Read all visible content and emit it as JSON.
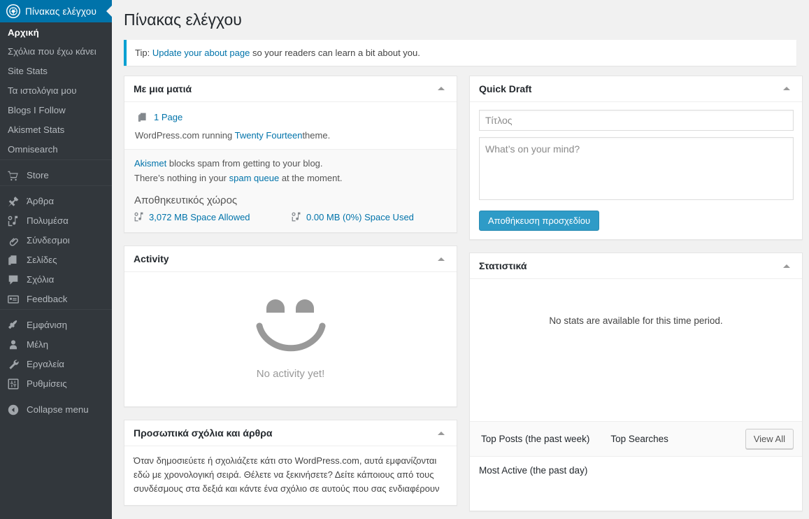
{
  "adminbar": {
    "logo_icon": "wordpress-dashboard-icon",
    "title": "Πίνακας ελέγχου"
  },
  "sidebar": {
    "top_items": [
      {
        "label": "Αρχική",
        "active": true
      },
      {
        "label": "Σχόλια που έχω κάνει",
        "active": false
      },
      {
        "label": "Site Stats",
        "active": false
      },
      {
        "label": "Τα ιστολόγια μου",
        "active": false
      },
      {
        "label": "Blogs I Follow",
        "active": false
      },
      {
        "label": "Akismet Stats",
        "active": false
      },
      {
        "label": "Omnisearch",
        "active": false
      }
    ],
    "store": {
      "label": "Store",
      "icon": "cart-icon"
    },
    "content_items": [
      {
        "label": "Άρθρα",
        "icon": "pin-icon"
      },
      {
        "label": "Πολυμέσα",
        "icon": "media-icon"
      },
      {
        "label": "Σύνδεσμοι",
        "icon": "link-icon"
      },
      {
        "label": "Σελίδες",
        "icon": "pages-icon"
      },
      {
        "label": "Σχόλια",
        "icon": "comment-icon"
      },
      {
        "label": "Feedback",
        "icon": "feedback-icon"
      }
    ],
    "admin_items": [
      {
        "label": "Εμφάνιση",
        "icon": "appearance-icon"
      },
      {
        "label": "Μέλη",
        "icon": "users-icon"
      },
      {
        "label": "Εργαλεία",
        "icon": "tools-icon"
      },
      {
        "label": "Ρυθμίσεις",
        "icon": "settings-icon"
      }
    ],
    "collapse": {
      "label": "Collapse menu",
      "icon": "collapse-arrow-icon"
    }
  },
  "page": {
    "title": "Πίνακας ελέγχου"
  },
  "tip": {
    "prefix": "Tip:",
    "link": "Update your about page",
    "suffix": "so your readers can learn a bit about you."
  },
  "glance": {
    "title": "Με μια ματιά",
    "page_count_link": "1 Page",
    "page_icon": "pages-icon",
    "version_prefix": "WordPress.com running",
    "theme_link": "Twenty Fourteen",
    "version_suffix": "theme.",
    "akismet_link": "Akismet",
    "akismet_text": "blocks spam from getting to your blog.",
    "spam_prefix": "There’s nothing in your",
    "spam_link": "spam queue",
    "spam_suffix": "at the moment.",
    "storage_title": "Αποθηκευτικός χώρος",
    "space_allowed": "3,072 MB Space Allowed",
    "space_used": "0.00 MB (0%) Space Used",
    "storage_icon": "media-icon"
  },
  "quick_draft": {
    "title": "Quick Draft",
    "title_placeholder": "Τίτλος",
    "title_value": "",
    "content_placeholder": "What’s on your mind?",
    "content_value": "",
    "save_label": "Αποθήκευση προσχεδίου"
  },
  "activity": {
    "title": "Activity",
    "empty_text": "No activity yet!",
    "face_icon": "smiley-face-icon"
  },
  "stats": {
    "title": "Στατιστικά",
    "empty_text": "No stats are available for this time period.",
    "tabs": [
      {
        "label": "Top Posts (the past week)"
      },
      {
        "label": "Top Searches"
      }
    ],
    "view_all_label": "View All",
    "most_active_label": "Most Active (the past day)"
  },
  "my_publications": {
    "title": "Προσωπικά σχόλια και άρθρα",
    "body": "Όταν δημοσιεύετε ή σχολιάζετε κάτι στο WordPress.com, αυτά εμφανίζονται εδώ με χρονολογική σειρά. Θέλετε να ξεκινήσετε? Δείτε κάποιους από τους συνδέσμους στα δεξιά και κάντε ένα σχόλιο σε αυτούς που σας ενδιαφέρουν"
  },
  "colors": {
    "brand_blue": "#0073aa",
    "link_blue": "#0073aa",
    "sidebar_bg": "#32373c",
    "page_bg": "#f1f1f1",
    "accent_button": "#2e9bc7"
  }
}
